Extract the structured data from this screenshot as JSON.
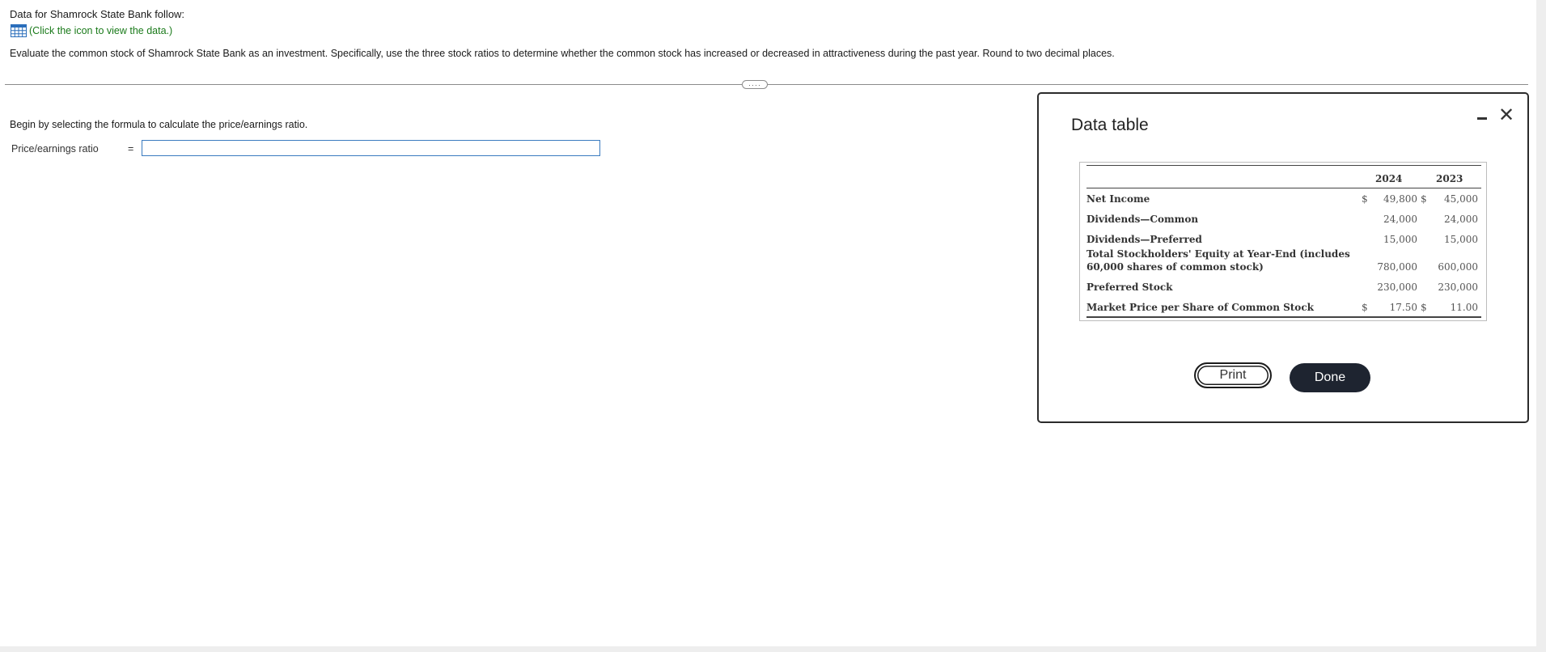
{
  "question": {
    "intro": "Data for Shamrock State Bank follow:",
    "data_link": "(Click the icon to view the data.)",
    "prompt": "Evaluate the common stock of Shamrock State Bank as an investment. Specifically, use the three stock ratios to determine whether the common stock has increased or decreased in attractiveness during the past year. Round to two decimal places.",
    "divider_handle": "····",
    "instruction": "Begin by selecting the formula to calculate the price/earnings ratio.",
    "ratio_label": "Price/earnings ratio",
    "equals": "=",
    "ratio_input_value": ""
  },
  "dialog": {
    "title": "Data table",
    "minimize_icon": "minus-icon",
    "close_icon": "close-icon",
    "close_glyph": "✕",
    "table": {
      "years": [
        "2024",
        "2023"
      ],
      "rows": [
        {
          "label": "Net Income",
          "dollar": "$",
          "v2024": "49,800",
          "mid": "$",
          "v2023": "45,000"
        },
        {
          "label": "Dividends—Common",
          "dollar": "",
          "v2024": "24,000",
          "mid": "",
          "v2023": "24,000"
        },
        {
          "label": "Dividends—Preferred",
          "dollar": "",
          "v2024": "15,000",
          "mid": "",
          "v2023": "15,000"
        },
        {
          "label": "Total Stockholders' Equity at Year-End (includes",
          "label2": "60,000 shares of common stock)",
          "dollar": "",
          "v2024": "780,000",
          "mid": "",
          "v2023": "600,000"
        },
        {
          "label": "Preferred Stock",
          "dollar": "",
          "v2024": "230,000",
          "mid": "",
          "v2023": "230,000"
        },
        {
          "label": "Market Price per Share of Common Stock",
          "dollar": "$",
          "v2024": "17.50",
          "mid": "$",
          "v2023": "11.00"
        }
      ]
    },
    "print_label": "Print",
    "done_label": "Done"
  }
}
